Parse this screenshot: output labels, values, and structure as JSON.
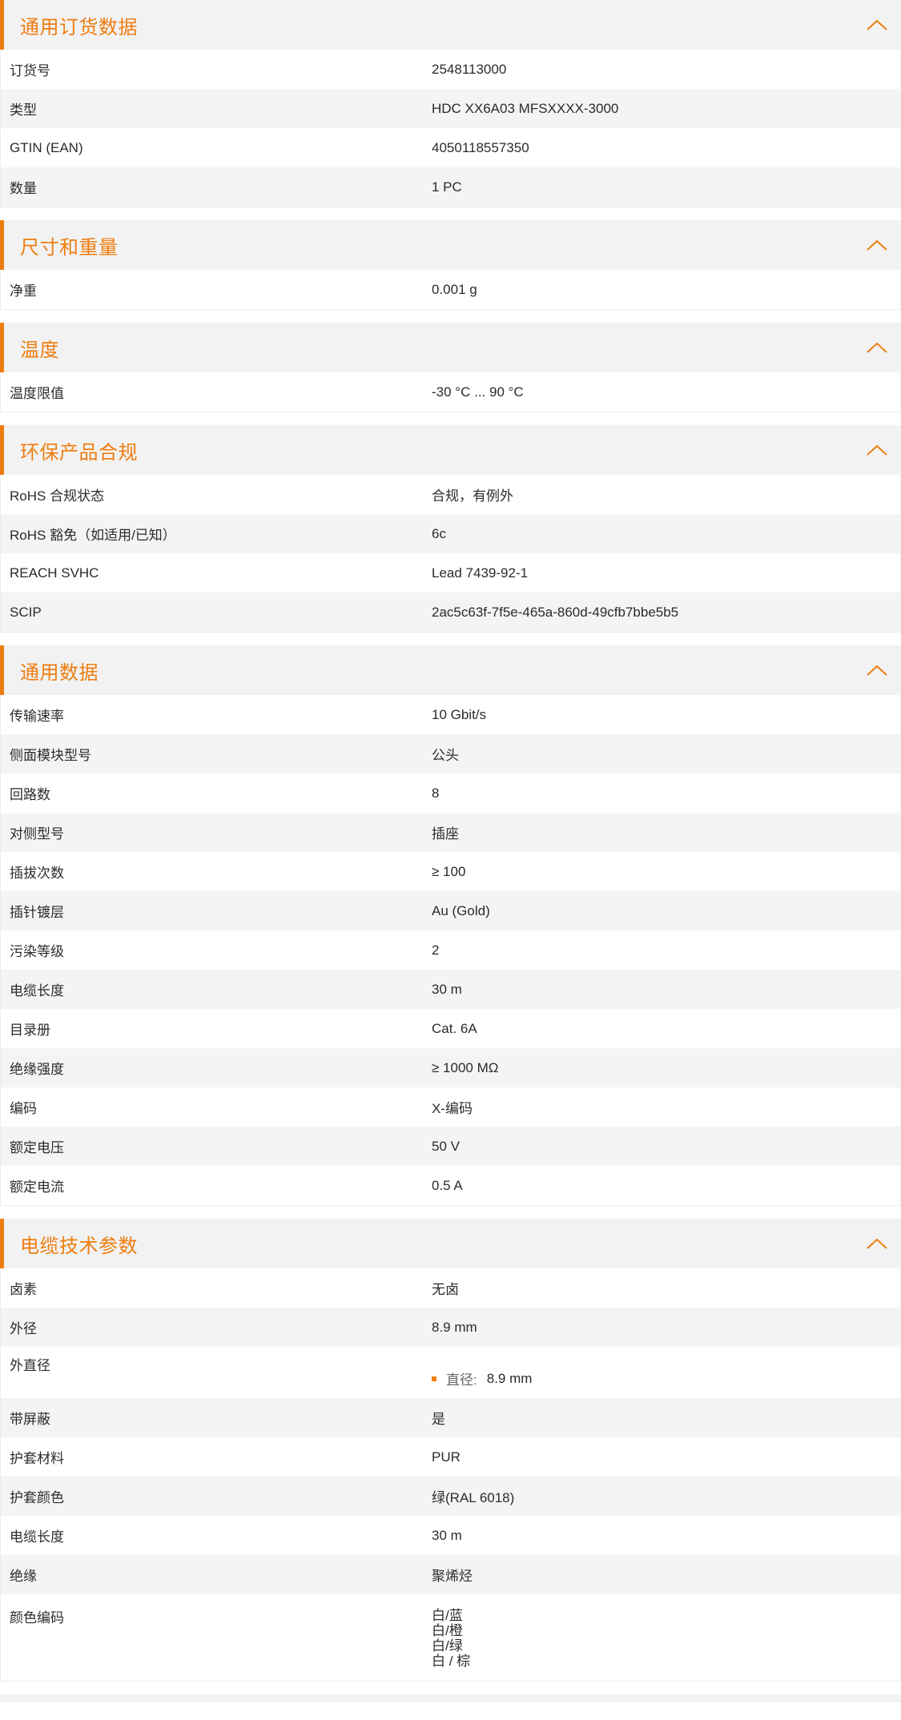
{
  "colors": {
    "accent": "#ee7d11",
    "header_bg": "#f2f2f2",
    "row_alt": "#f4f4f4"
  },
  "icons": {
    "collapse": "chevron-up-icon"
  },
  "sections": [
    {
      "title": "通用订货数据",
      "rows": [
        {
          "k": "订货号",
          "v": "2548113000"
        },
        {
          "k": "类型",
          "v": "HDC XX6A03 MFSXXXX-3000"
        },
        {
          "k": "GTIN (EAN)",
          "v": "4050118557350"
        },
        {
          "k": "数量",
          "v": "1  PC"
        }
      ]
    },
    {
      "title": "尺寸和重量",
      "rows": [
        {
          "k": "净重",
          "v": "0.001  g"
        }
      ]
    },
    {
      "title": "温度",
      "rows": [
        {
          "k": "温度限值",
          "v": "-30 °C ... 90 °C"
        }
      ]
    },
    {
      "title": "环保产品合规",
      "rows": [
        {
          "k": "RoHS 合规状态",
          "v": "合规，有例外"
        },
        {
          "k": "RoHS 豁免（如适用/已知）",
          "v": "6c"
        },
        {
          "k": "REACH SVHC",
          "v": "Lead 7439-92-1"
        },
        {
          "k": "SCIP",
          "v": "2ac5c63f-7f5e-465a-860d-49cfb7bbe5b5"
        }
      ]
    },
    {
      "title": "通用数据",
      "rows": [
        {
          "k": "传输速率",
          "v": "10 Gbit/s"
        },
        {
          "k": "侧面模块型号",
          "v": "公头"
        },
        {
          "k": "回路数",
          "v": "8"
        },
        {
          "k": "对侧型号",
          "v": "插座"
        },
        {
          "k": "插拔次数",
          "v": "≥ 100"
        },
        {
          "k": "插针镀层",
          "v": "Au (Gold)"
        },
        {
          "k": "污染等级",
          "v": "2"
        },
        {
          "k": "电缆长度",
          "v": "30  m"
        },
        {
          "k": "目录册",
          "v": "Cat. 6A"
        },
        {
          "k": "绝缘强度",
          "v": "≥ 1000 MΩ"
        },
        {
          "k": "编码",
          "v": "X-编码"
        },
        {
          "k": "额定电压",
          "v": "50  V"
        },
        {
          "k": "额定电流",
          "v": "0.5  A"
        }
      ]
    },
    {
      "title": "电缆技术参数",
      "rows": [
        {
          "k": "卤素",
          "v": "无卤"
        },
        {
          "k": "外径",
          "v": "8.9 mm"
        },
        {
          "k": "外直径",
          "bullet_label": "直径:",
          "bullet_value": "8.9 mm"
        },
        {
          "k": "带屏蔽",
          "v": "是"
        },
        {
          "k": "护套材料",
          "v": "PUR"
        },
        {
          "k": "护套颜色",
          "v": "绿(RAL 6018)"
        },
        {
          "k": "电缆长度",
          "v": "30  m"
        },
        {
          "k": "绝缘",
          "v": "聚烯烃"
        },
        {
          "k": "颜色编码",
          "lines": [
            "白/蓝",
            "白/橙",
            "白/绿",
            "白 / 棕"
          ]
        }
      ]
    }
  ]
}
